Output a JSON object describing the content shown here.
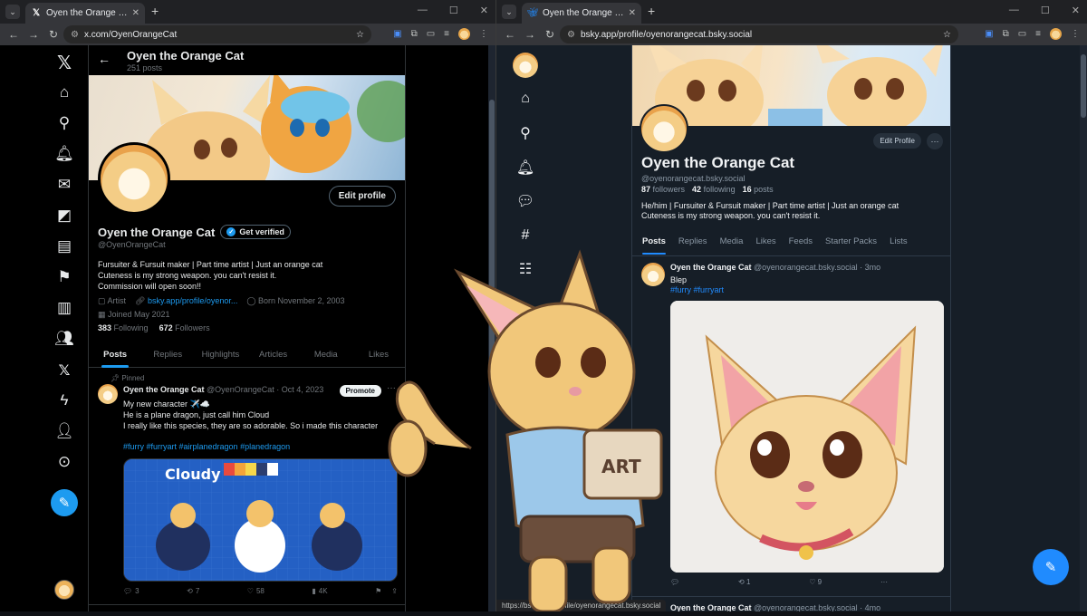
{
  "left_browser": {
    "tab_title": "Oyen the Orange Cat (@OyenO...",
    "url": "x.com/OyenOrangeCat"
  },
  "right_browser": {
    "tab_title": "Oyen the Orange Cat (@oyeno...",
    "url": "bsky.app/profile/oyenorangecat.bsky.social",
    "status_url": "https://bsky.app/profile/oyenorangecat.bsky.social"
  },
  "x_profile": {
    "header_name": "Oyen the Orange Cat",
    "post_count": "251 posts",
    "edit_profile_label": "Edit profile",
    "display_name": "Oyen the Orange Cat",
    "get_verified_label": "Get verified",
    "handle": "@OyenOrangeCat",
    "bio_lines": [
      "Fursuiter & Fursuit maker | Part time artist | Just an orange cat",
      "Cuteness is my strong weapon. you can't resist it.",
      "Commission will open soon!!"
    ],
    "meta": {
      "category": "Artist",
      "link": "bsky.app/profile/oyenor...",
      "born": "Born November 2, 2003",
      "joined": "Joined May 2021"
    },
    "following_count": "383",
    "following_label": "Following",
    "followers_count": "672",
    "followers_label": "Followers",
    "tabs": [
      "Posts",
      "Replies",
      "Highlights",
      "Articles",
      "Media",
      "Likes"
    ],
    "pinned_label": "Pinned",
    "post": {
      "author": "Oyen the Orange Cat",
      "handle_date": "@OyenOrangeCat · Oct 4, 2023",
      "promote_label": "Promote",
      "text_lines": [
        "My new character ✈️☁️",
        "He is a plane dragon, just call him Cloud",
        "I really like this species, they are so adorable. So i made this character"
      ],
      "hashtags": "#furry #furryart #airplanedragon #planedragon",
      "media_title": "Cloudy",
      "replies": "3",
      "reposts": "7",
      "likes": "58",
      "views": "4K"
    }
  },
  "bsky_profile": {
    "edit_profile_label": "Edit Profile",
    "display_name": "Oyen the Orange Cat",
    "handle": "@oyenorangecat.bsky.social",
    "followers_count": "87",
    "followers_label": "followers",
    "following_count": "42",
    "following_label": "following",
    "posts_count": "16",
    "posts_label": "posts",
    "bio_lines": [
      "He/him | Fursuiter & Fursuit maker | Part time artist | Just an orange cat",
      "Cuteness is my strong weapon. you can't resist it."
    ],
    "tabs": [
      "Posts",
      "Replies",
      "Media",
      "Likes",
      "Feeds",
      "Starter Packs",
      "Lists"
    ],
    "post": {
      "author": "Oyen the Orange Cat",
      "handle_time": "@oyenorangecat.bsky.social · 3mo",
      "text": "Blep",
      "hashtags": "#furry #furryart",
      "reposts": "1",
      "likes": "9"
    },
    "next_post": {
      "author": "Oyen the Orange Cat",
      "handle_time": "@oyenorangecat.bsky.social · 4mo"
    }
  },
  "overlay": {
    "box_label": "ART"
  },
  "colors": {
    "x_accent": "#1d9bf0",
    "bsky_accent": "#208bfe",
    "x_bg": "#000000",
    "bsky_bg": "#161e27"
  }
}
